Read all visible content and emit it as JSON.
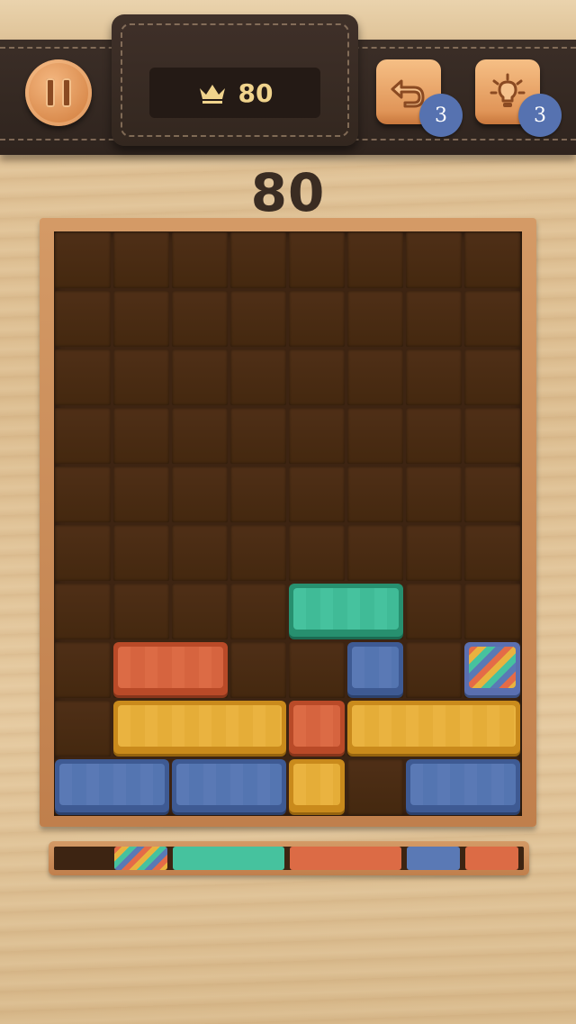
{
  "header": {
    "best_score": "80",
    "undo_count": "3",
    "hint_count": "3"
  },
  "score": "80",
  "icons": {
    "pause": "pause-icon",
    "crown": "crown-icon",
    "undo": "undo-icon",
    "hint": "lightbulb-icon"
  },
  "colors": {
    "blue": "#5a79b5",
    "yellow": "#eab340",
    "orange": "#dc6b45",
    "teal": "#46c29e",
    "board": "#3d2412",
    "badge": "#5672b0"
  },
  "board": {
    "columns": 8,
    "rows": 10,
    "blocks": [
      {
        "color": "teal",
        "row": 6,
        "col": 4,
        "width": 2
      },
      {
        "color": "orange",
        "row": 7,
        "col": 1,
        "width": 2
      },
      {
        "color": "blue",
        "row": 7,
        "col": 5,
        "width": 1
      },
      {
        "color": "rainbow",
        "row": 7,
        "col": 7,
        "width": 1
      },
      {
        "color": "yellow",
        "row": 8,
        "col": 1,
        "width": 3
      },
      {
        "color": "orange",
        "row": 8,
        "col": 4,
        "width": 1
      },
      {
        "color": "yellow",
        "row": 8,
        "col": 5,
        "width": 3
      },
      {
        "color": "blue",
        "row": 9,
        "col": 0,
        "width": 2
      },
      {
        "color": "blue",
        "row": 9,
        "col": 2,
        "width": 2
      },
      {
        "color": "yellow",
        "row": 9,
        "col": 4,
        "width": 1
      },
      {
        "color": "blue",
        "row": 9,
        "col": 6,
        "width": 2
      }
    ]
  },
  "next_row": [
    {
      "color": "rainbow",
      "col": 1,
      "width": 1
    },
    {
      "color": "teal",
      "col": 2,
      "width": 2
    },
    {
      "color": "orange",
      "col": 4,
      "width": 2
    },
    {
      "color": "blue",
      "col": 6,
      "width": 1
    },
    {
      "color": "orange",
      "col": 7,
      "width": 1
    }
  ]
}
